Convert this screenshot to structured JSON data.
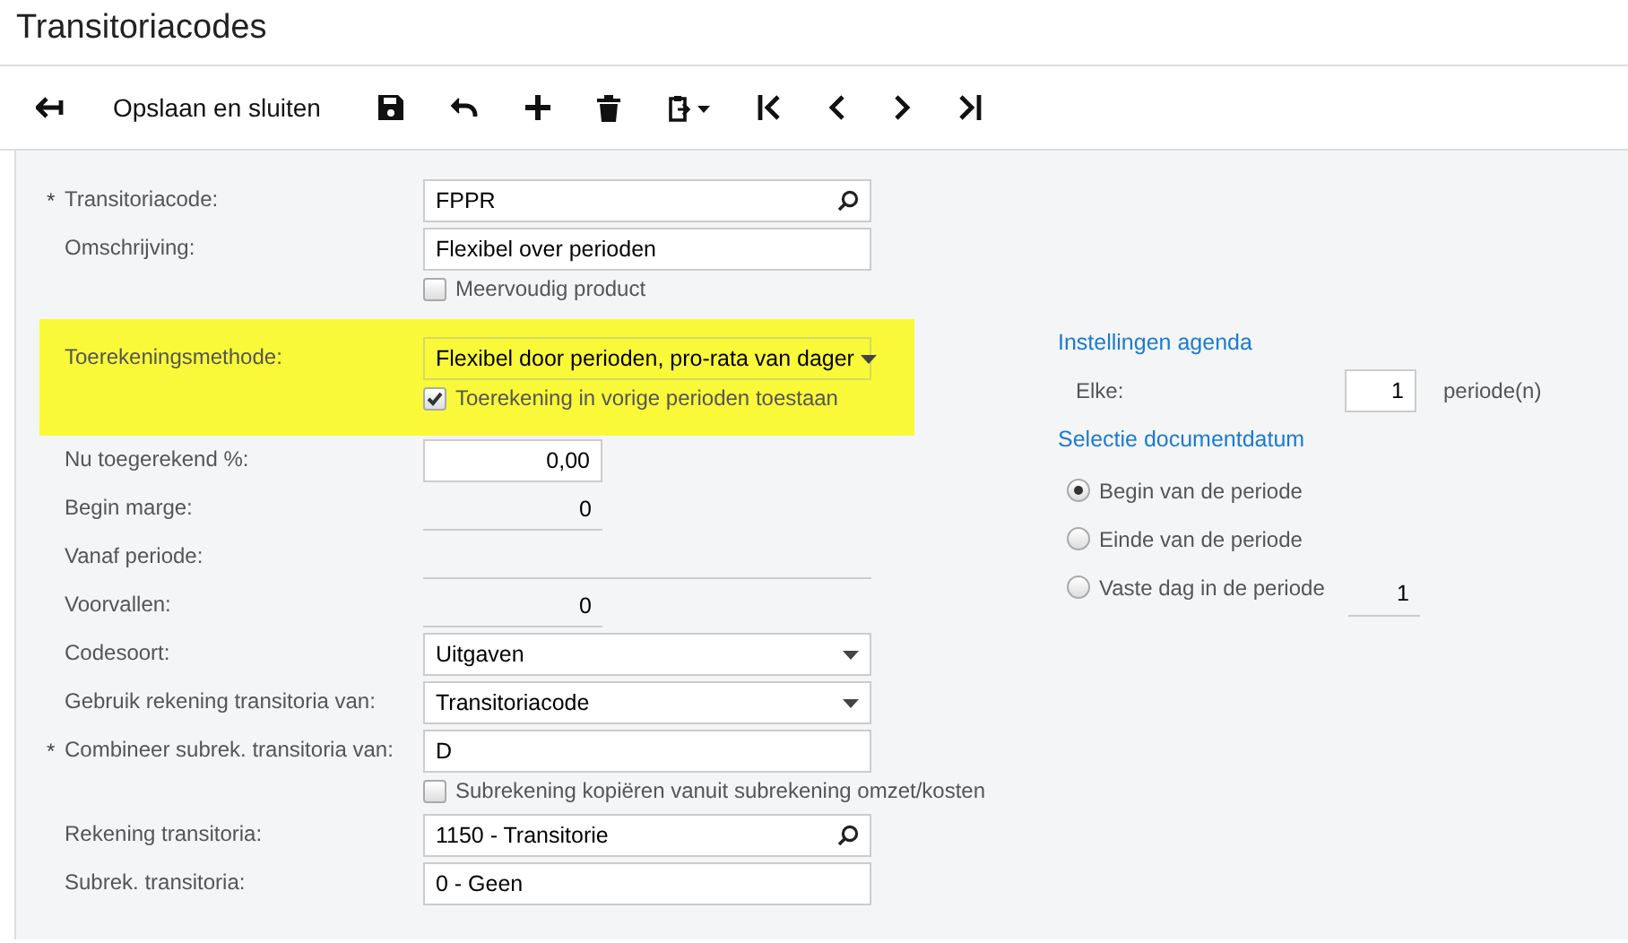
{
  "title": "Transitoriacodes",
  "toolbar": [
    {
      "kind": "back"
    },
    {
      "kind": "text",
      "label": "Opslaan en sluiten"
    },
    {
      "kind": "save"
    },
    {
      "kind": "undo"
    },
    {
      "kind": "add"
    },
    {
      "kind": "delete"
    },
    {
      "kind": "paste"
    },
    {
      "kind": "first"
    },
    {
      "kind": "prev"
    },
    {
      "kind": "next"
    },
    {
      "kind": "last"
    }
  ],
  "form": [
    {
      "kind": "lookup",
      "label": "Transitoriacode:",
      "required_mark": "*",
      "value": "FPPR"
    },
    {
      "kind": "text",
      "label": "Omschrijving:",
      "value": "Flexibel over perioden"
    },
    {
      "kind": "checkbox",
      "label": "Meervoudig product",
      "checked": false
    },
    {
      "kind": "highlight",
      "rows": [
        {
          "kind": "select",
          "label": "Toerekeningsmethode:",
          "value": "Flexibel door perioden, pro-rata van dager"
        },
        {
          "kind": "checkbox",
          "label": "Toerekening in vorige perioden toestaan",
          "checked": true
        }
      ]
    },
    {
      "kind": "number",
      "label": "Nu toegerekend %:",
      "value": "0,00"
    },
    {
      "kind": "display",
      "label": "Begin marge:",
      "value": "0"
    },
    {
      "kind": "display_wide",
      "label": "Vanaf periode:"
    },
    {
      "kind": "display",
      "label": "Voorvallen:",
      "value": "0"
    },
    {
      "kind": "select",
      "label": "Codesoort:",
      "value": "Uitgaven"
    },
    {
      "kind": "select",
      "label": "Gebruik rekening transitoria van:",
      "value": "Transitoriacode"
    },
    {
      "kind": "text",
      "label": "Combineer subrek. transitoria van:",
      "required_mark": "*",
      "value": "D"
    },
    {
      "kind": "checkbox",
      "label": "Subrekening kopiëren vanuit subrekening omzet/kosten",
      "checked": false
    },
    {
      "kind": "lookup",
      "label": "Rekening transitoria:",
      "value": "1150 - Transitorie"
    },
    {
      "kind": "text",
      "label": "Subrek. transitoria:",
      "value": "0 - Geen"
    }
  ],
  "schedule": {
    "heading": "Instellingen agenda",
    "every_label": "Elke:",
    "every_value": "1",
    "unit": "periode(n)"
  },
  "document_date": {
    "heading": "Selectie documentdatum",
    "options": [
      {
        "label": "Begin van de periode",
        "selected": true
      },
      {
        "label": "Einde van de periode",
        "selected": false
      },
      {
        "label": "Vaste dag in de periode",
        "selected": false,
        "value": "1"
      }
    ]
  }
}
